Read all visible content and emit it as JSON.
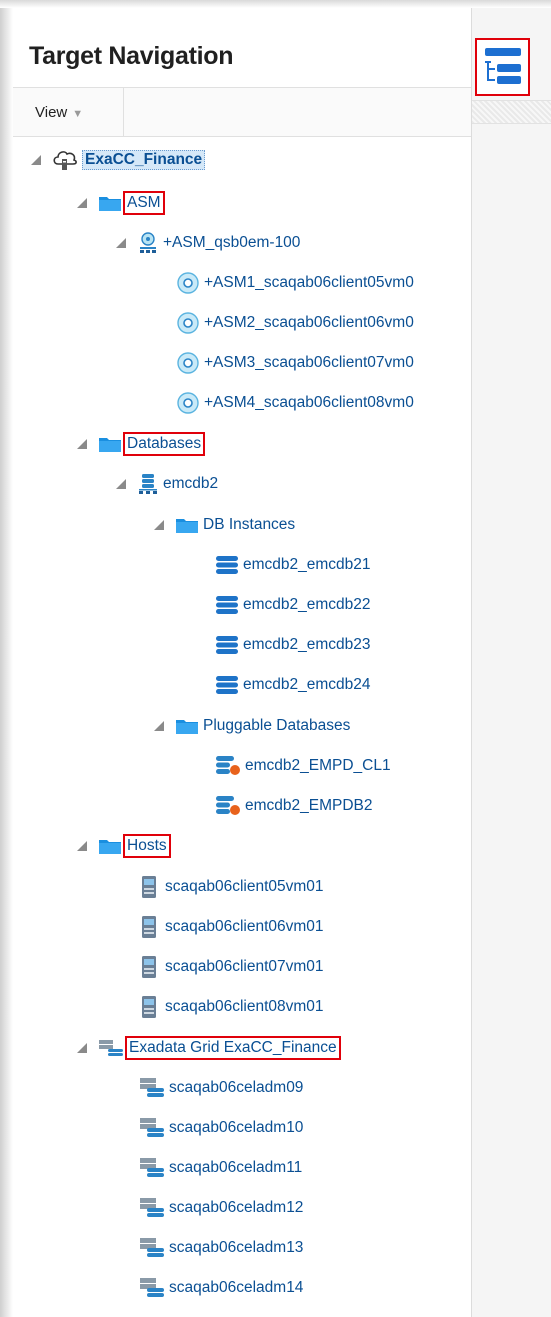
{
  "panel": {
    "title": "Target Navigation",
    "view_menu_label": "View",
    "accent_color": "#e0000a",
    "link_color": "#0a4f93"
  },
  "tree": {
    "root": {
      "label": "ExaCC_Finance",
      "icon": "cloud-target-icon"
    },
    "asm": {
      "label": "ASM",
      "icon": "folder-icon",
      "cluster": {
        "label": "+ASM_qsb0em-100",
        "icon": "asm-cluster-icon"
      },
      "instances": [
        "+ASM1_scaqab06client05vm0",
        "+ASM2_scaqab06client06vm0",
        "+ASM3_scaqab06client07vm0",
        "+ASM4_scaqab06client08vm0"
      ]
    },
    "databases": {
      "label": "Databases",
      "icon": "folder-icon",
      "db": {
        "label": "emcdb2",
        "icon": "cluster-database-icon"
      },
      "db_instances": {
        "label": "DB Instances",
        "items": [
          "emcdb2_emcdb21",
          "emcdb2_emcdb22",
          "emcdb2_emcdb23",
          "emcdb2_emcdb24"
        ]
      },
      "pluggable": {
        "label": "Pluggable Databases",
        "items": [
          "emcdb2_EMPD_CL1",
          "emcdb2_EMPDB2"
        ]
      }
    },
    "hosts": {
      "label": "Hosts",
      "icon": "folder-icon",
      "items": [
        "scaqab06client05vm01",
        "scaqab06client06vm01",
        "scaqab06client07vm01",
        "scaqab06client08vm01"
      ]
    },
    "exadata": {
      "label": "Exadata Grid ExaCC_Finance",
      "icon": "exadata-grid-icon",
      "items": [
        "scaqab06celadm09",
        "scaqab06celadm10",
        "scaqab06celadm11",
        "scaqab06celadm12",
        "scaqab06celadm13",
        "scaqab06celadm14"
      ]
    }
  }
}
